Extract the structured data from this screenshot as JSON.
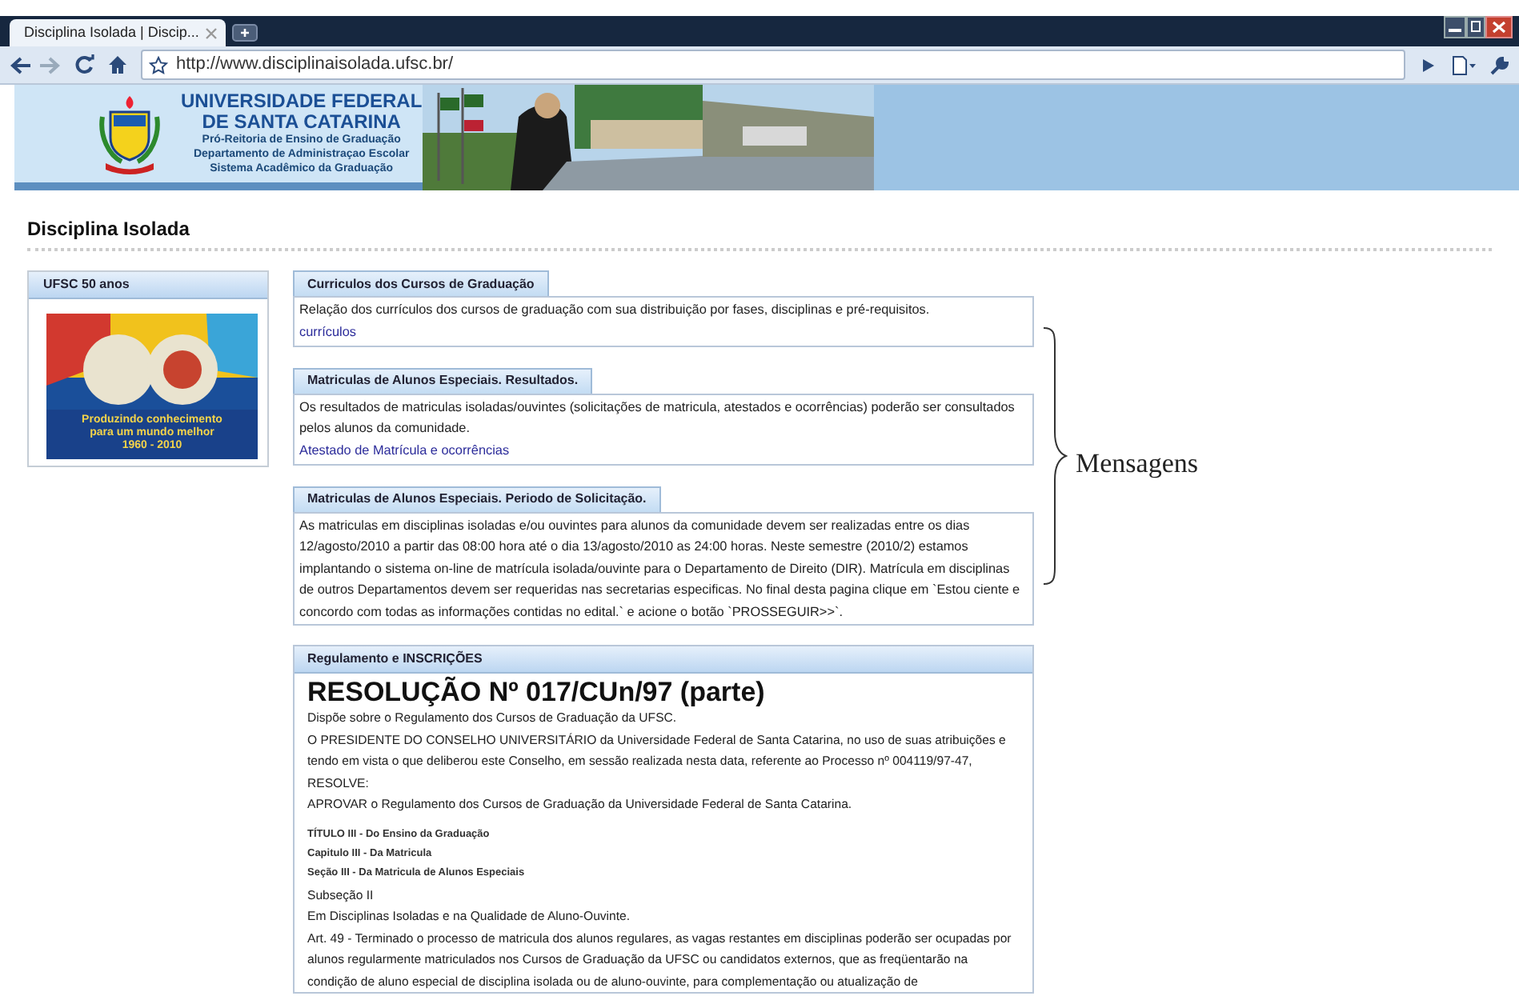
{
  "browser": {
    "tab_title": "Disciplina Isolada | Discip...",
    "url": "http://www.disciplinaisolada.ufsc.br/"
  },
  "banner": {
    "title_lines": [
      "UNIVERSIDADE FEDERAL",
      "DE SANTA CATARINA"
    ],
    "subtitle_lines": [
      "Pró-Reitoria de Ensino de Graduação",
      "Departamento de Administraçao Escolar",
      "Sistema Acadêmico da Graduação"
    ]
  },
  "page_title": "Disciplina Isolada",
  "sidebar": {
    "title": "UFSC 50 anos",
    "caption_lines": [
      "Produzindo conhecimento",
      "para um mundo melhor",
      "1960 - 2010"
    ]
  },
  "notices": [
    {
      "title": "Curriculos dos Cursos de Graduação",
      "text": "Relação dos currículos dos cursos de graduação com sua distribuição por fases, disciplinas e pré-requisitos.",
      "link": "currículos"
    },
    {
      "title": "Matriculas de Alunos Especiais. Resultados.",
      "text": "Os resultados de matriculas isoladas/ouvintes (solicitações de matricula, atestados e ocorrências) poderão ser consultados pelos alunos da comunidade.",
      "link": "Atestado de Matrícula e ocorrências"
    },
    {
      "title": "Matriculas de Alunos Especiais. Periodo de Solicitação.",
      "text": "As matriculas em disciplinas isoladas e/ou ouvintes para alunos da comunidade devem ser realizadas entre os dias 12/agosto/2010 a partir das 08:00 hora até o dia 13/agosto/2010 as 24:00 horas. Neste semestre (2010/2) estamos implantando o sistema on-line de matrícula isolada/ouvinte para o Departamento de Direito (DIR). Matrícula em disciplinas de outros Departamentos devem ser requeridas nas secretarias especificas. No final desta pagina clique em `Estou ciente e concordo com todas as informações contidas no edital.` e acione o botão `PROSSEGUIR>>`."
    }
  ],
  "annotation": "Mensagens",
  "regulation": {
    "title": "Regulamento e INSCRIÇÕES",
    "heading": "RESOLUÇÃO Nº 017/CUn/97 (parte)",
    "items": [
      {
        "kind": "text",
        "text": "Dispõe sobre o Regulamento dos Cursos de Graduação da UFSC."
      },
      {
        "kind": "text",
        "text": "O PRESIDENTE DO CONSELHO UNIVERSITÁRIO da Universidade Federal de Santa Catarina, no uso de suas atribuições e tendo em vista o que deliberou este Conselho, em sessão realizada nesta data, referente ao Processo nº 004119/97-47,"
      },
      {
        "kind": "text",
        "text": "RESOLVE:"
      },
      {
        "kind": "text",
        "text": "APROVAR o Regulamento dos Cursos de Graduação da Universidade Federal de Santa Catarina."
      },
      {
        "kind": "section",
        "text": "TÍTULO III - Do Ensino da Graduação"
      },
      {
        "kind": "section",
        "text": "Capitulo III - Da Matricula"
      },
      {
        "kind": "section",
        "text": "Seção III - Da Matricula de Alunos Especiais"
      },
      {
        "kind": "text",
        "text": "Subseção II"
      },
      {
        "kind": "text",
        "text": "Em Disciplinas Isoladas e na Qualidade de Aluno-Ouvinte."
      },
      {
        "kind": "text",
        "text": "Art. 49 - Terminado o processo de matricula dos alunos regulares, as vagas restantes em disciplinas poderão ser ocupadas por alunos regularmente matriculados nos Cursos de Graduação da UFSC ou candidatos externos, que as freqüentarão na condição de aluno especial de disciplina isolada ou de aluno-ouvinte, para complementação ou atualização de"
      }
    ]
  }
}
